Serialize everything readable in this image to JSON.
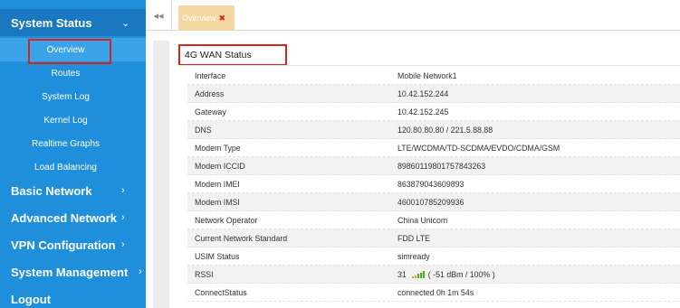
{
  "sidebar": {
    "system_status": "System Status",
    "system_status_arrow": "⌄",
    "items": [
      {
        "label": "Overview"
      },
      {
        "label": "Routes"
      },
      {
        "label": "System Log"
      },
      {
        "label": "Kernel Log"
      },
      {
        "label": "Realtime Graphs"
      },
      {
        "label": "Load Balancing"
      }
    ],
    "groups": [
      {
        "label": "Basic Network",
        "arrow": "›"
      },
      {
        "label": "Advanced Network",
        "arrow": "›"
      },
      {
        "label": "VPN Configuration",
        "arrow": "›"
      },
      {
        "label": "System Management",
        "arrow": "›"
      },
      {
        "label": "Logout"
      }
    ]
  },
  "tabs": {
    "back_icon": "◂◂",
    "active_label": "Overview",
    "close_glyph": "✖"
  },
  "panel": {
    "title": "4G WAN Status",
    "rows": [
      {
        "key": "Interface",
        "value": "Mobile Network1"
      },
      {
        "key": "Address",
        "value": "10.42.152.244"
      },
      {
        "key": "Gateway",
        "value": "10.42.152.245"
      },
      {
        "key": "DNS",
        "value": "120.80.80.80 / 221.5.88.88"
      },
      {
        "key": "Modem Type",
        "value": "LTE/WCDMA/TD-SCDMA/EVDO/CDMA/GSM"
      },
      {
        "key": "Modem ICCID",
        "value": "89860119801757843263"
      },
      {
        "key": "Modem IMEI",
        "value": "863879043609893"
      },
      {
        "key": "Modem IMSI",
        "value": "460010785209936"
      },
      {
        "key": "Network Operator",
        "value": "China Unicom"
      },
      {
        "key": "Current Network Standard",
        "value": "FDD LTE"
      },
      {
        "key": "USIM Status",
        "value": "simready"
      },
      {
        "key": "RSSI",
        "value": "31",
        "extra": "( -51 dBm / 100% )"
      },
      {
        "key": "ConnectStatus",
        "value": "connected 0h 1m 54s"
      }
    ]
  },
  "colors": {
    "sidebar_bg": "#1f8fdc",
    "sidebar_active": "#1978bf",
    "highlight_border": "#d9231b",
    "tab_active_bg": "#f4d7a1",
    "signal_green": "#3fb618",
    "signal_orange": "#f39c12"
  }
}
